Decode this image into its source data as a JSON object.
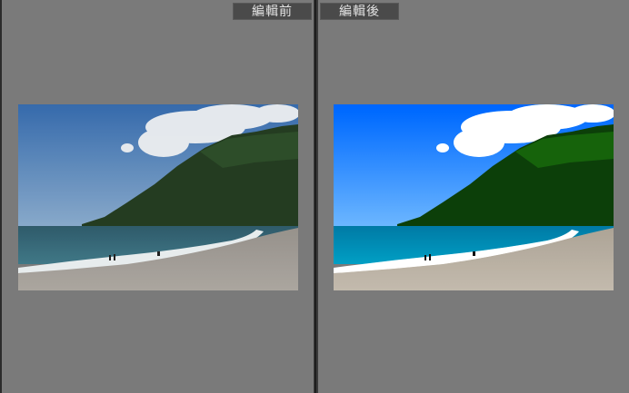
{
  "panes": {
    "before": {
      "label": "編輯前"
    },
    "after": {
      "label": "編輯後"
    }
  },
  "colors": {
    "pane_background": "#7a7a7a",
    "window_background": "#2b2b2b",
    "label_background": "#4a4a4a",
    "label_text": "#e4e4e4",
    "sky_before": "#3f7fc7",
    "sky_after": "#1f6fdc",
    "sea_before": "#2f6f84",
    "sea_after": "#1d7fa0",
    "hill": "#1f3a1c",
    "sand": "#a9a39b"
  },
  "photo": {
    "subject": "beach-landscape"
  }
}
